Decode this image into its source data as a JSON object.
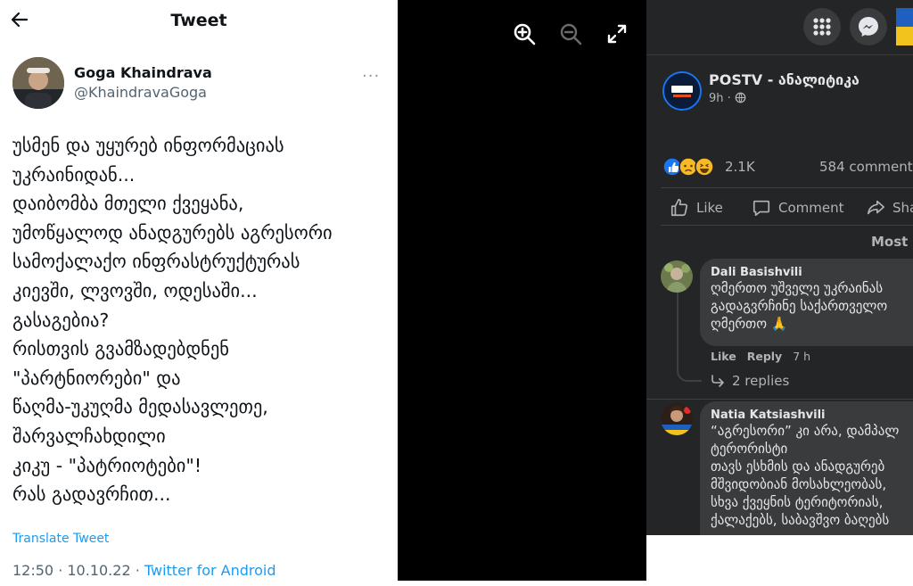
{
  "twitter": {
    "header_title": "Tweet",
    "author_name": "Goga Khaindrava",
    "author_handle": "@KhaindravaGoga",
    "more_glyph": "···",
    "tweet_lines": [
      "უსმენ და უყურებ ინფორმაციას",
      "უკრაინიდან...",
      "დაიბომბა მთელი ქვეყანა,",
      "უმოწყალოდ ანადგურებს აგრესორი",
      "სამოქალაქო ინფრასტრუქტურას",
      "კიევში, ლვოვში, ოდესაში...",
      "გასაგებია?",
      "რისთვის გვამზადებდნენ",
      "\"პარტნიორები\" და",
      "წაღმა-უკუღმა მედასავლეთე,",
      "შარვალჩახდილი",
      "კიკუ - \"პატრიოტები\"!",
      "რას გადავრჩით..."
    ],
    "translate_label": "Translate Tweet",
    "timestamp": "12:50 · 10.10.22 · ",
    "source": "Twitter for Android"
  },
  "viewer": {
    "icons": [
      "zoom-in-icon",
      "zoom-out-icon",
      "fullscreen-icon"
    ]
  },
  "facebook": {
    "page_name": "POSTV - ანალიტიკა",
    "post_time": "9h · ",
    "reaction_count": "2.1K",
    "comments_count": "584 comments",
    "actions": {
      "like": "Like",
      "comment": "Comment",
      "share": "Sha"
    },
    "sort_label": "Most r",
    "comments": [
      {
        "author": "Dali Basishvili",
        "lines": [
          "ღმერთო უშველე უკრაინას",
          "გადაგვრჩინე საქართველო",
          "ღმერთო 🙏"
        ],
        "like_label": "Like",
        "reply_label": "Reply",
        "time": "7 h",
        "replies": "2 replies"
      },
      {
        "author": "Natia Katsiashvili",
        "lines": [
          "“აგრესორი” კი არა, დამპალ",
          "ტერორისტი",
          "თავს ესხმის და ანადგურებ",
          "მშვიდობიან მოსახლეობას,",
          "სხვა ქვეყნის ტერიტორიას,",
          "ქალაქებს, საბავშვო ბაღებს"
        ]
      }
    ],
    "colors": {
      "bg": "#242526",
      "bubble": "#3a3b3c",
      "accent": "#1877f2"
    }
  }
}
